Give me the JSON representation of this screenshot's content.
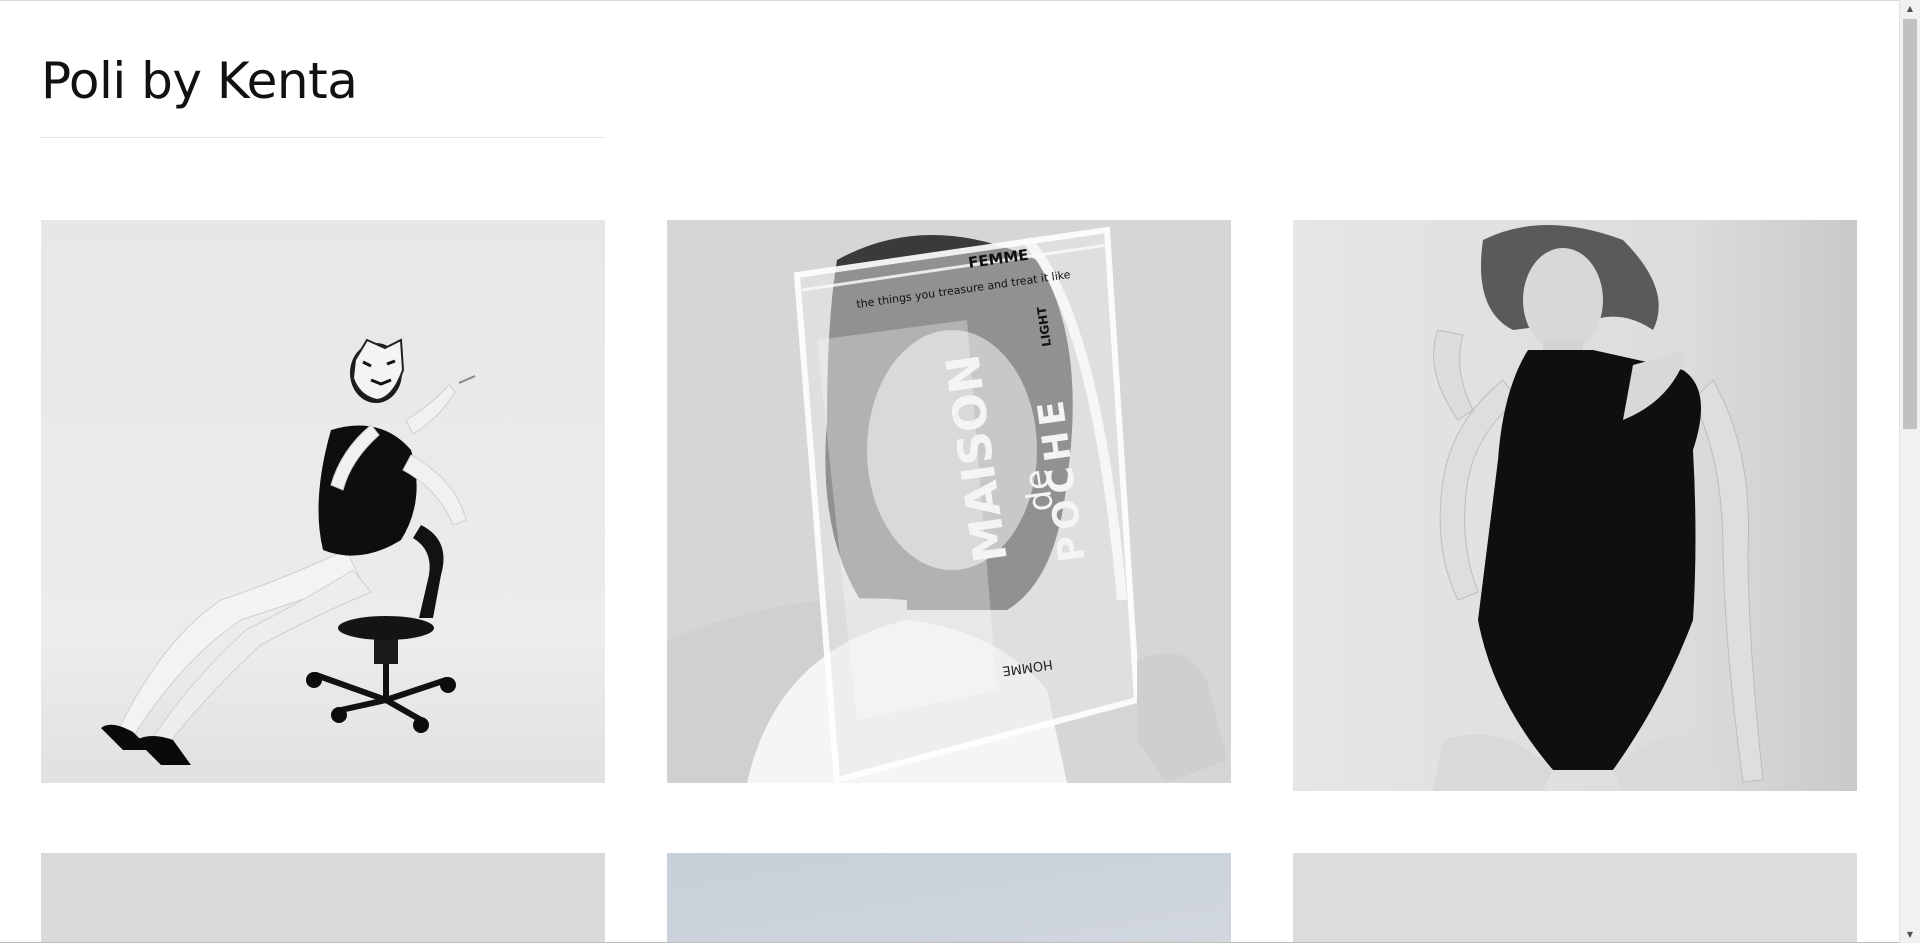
{
  "site": {
    "title": "Poli by Kenta"
  },
  "gallery": {
    "items": [
      {
        "label": "masked-model-on-office-chair",
        "tone": "bw"
      },
      {
        "label": "model-behind-clear-bag",
        "tone": "bw",
        "bag_text": {
          "top": "FEMME",
          "brand1": "MAISON",
          "brand2": "de",
          "brand3": "POCHE",
          "side": "LIGHT",
          "bottom": "HOMME",
          "tagline": "the things you treasure and treat it like"
        }
      },
      {
        "label": "model-in-black-bodysuit",
        "tone": "bw"
      },
      {
        "label": "gallery-photo-4",
        "tone": "light-grey"
      },
      {
        "label": "gallery-photo-5",
        "tone": "blue-grey"
      },
      {
        "label": "gallery-photo-6",
        "tone": "light-grey"
      }
    ]
  },
  "colors": {
    "background": "#ffffff",
    "text": "#111111",
    "divider": "#e6e6e6",
    "scrollbar_track": "#f1f1f1",
    "scrollbar_thumb": "#c1c1c1"
  },
  "scrollbar": {
    "up_icon": "triangle-up",
    "down_icon": "triangle-down"
  }
}
